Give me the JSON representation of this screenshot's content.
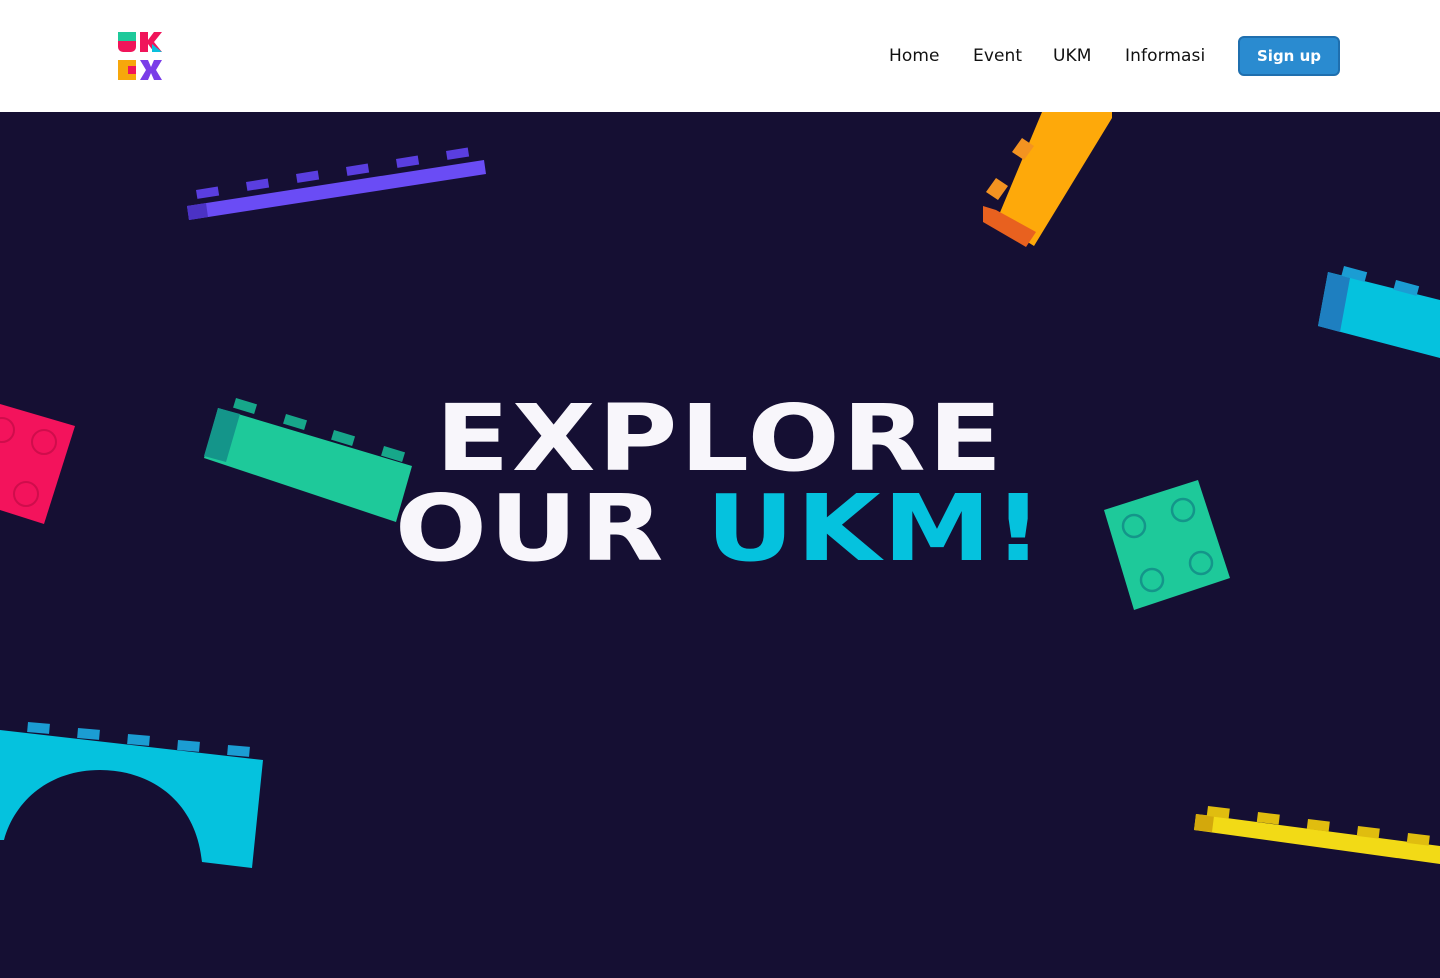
{
  "nav": {
    "items": [
      {
        "label": "Home"
      },
      {
        "label": "Event"
      },
      {
        "label": "UKM"
      },
      {
        "label": "Informasi"
      }
    ],
    "signup_label": "Sign up"
  },
  "hero": {
    "line1": "EXPLORE",
    "line2_plain": "OUR",
    "line2_accent": "UKM!"
  },
  "colors": {
    "background": "#150f33",
    "accent": "#05c2de",
    "button": "#2a8bd0"
  }
}
